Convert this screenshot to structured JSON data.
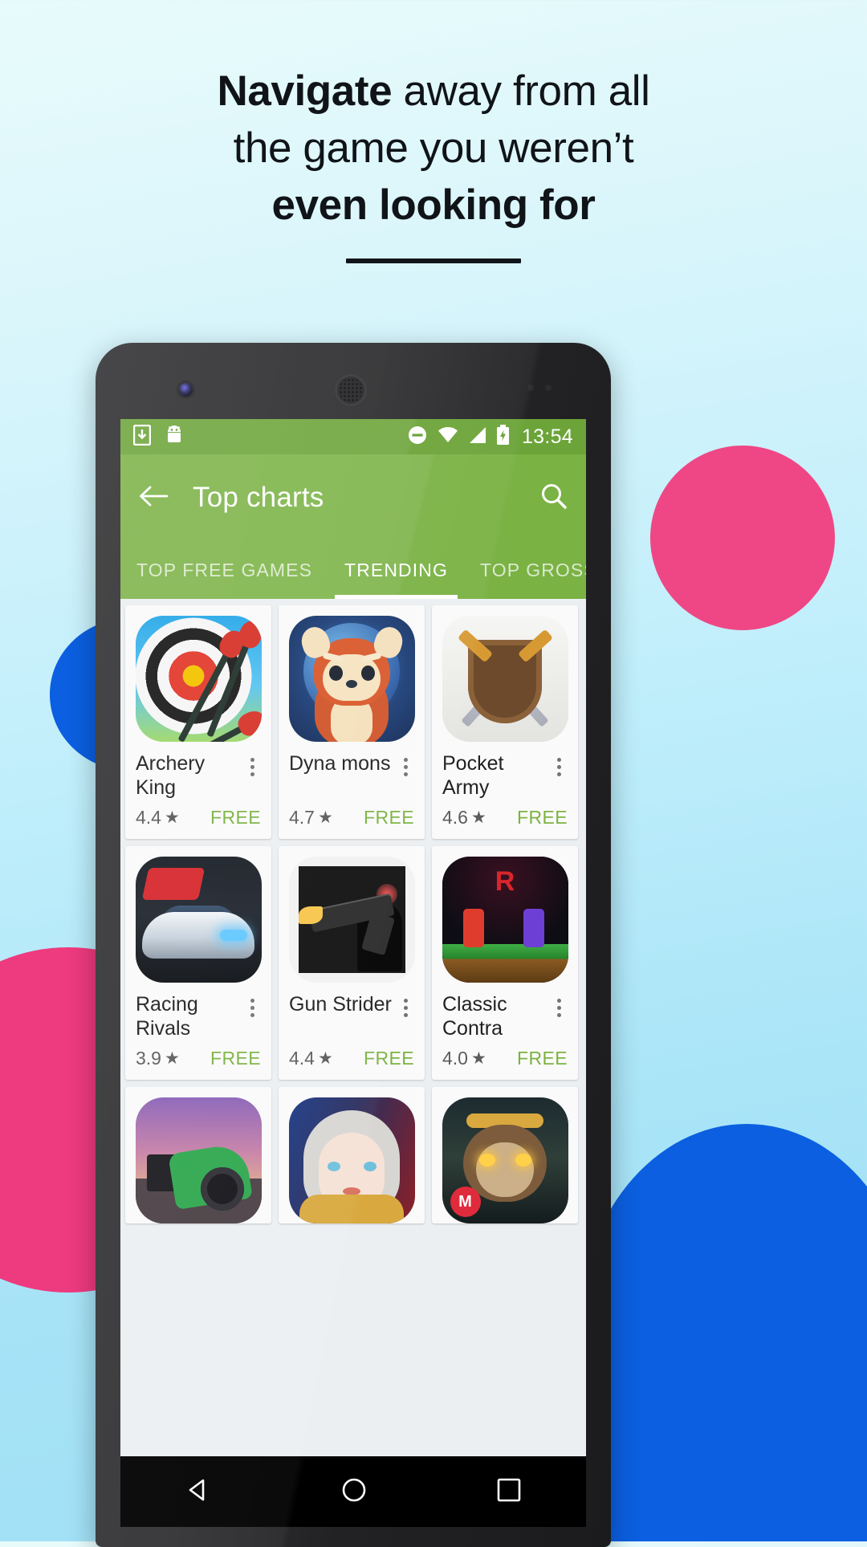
{
  "promo": {
    "headline_line1_bold": "Navigate",
    "headline_line1_rest": " away from all",
    "headline_line2": "the game you weren’t",
    "headline_line3": "even looking for"
  },
  "phone": {
    "statusbar": {
      "time": "13:54",
      "icons_left": [
        "download-icon",
        "android-icon"
      ],
      "icons_right": [
        "do-not-disturb-icon",
        "wifi-icon",
        "signal-icon",
        "battery-charging-icon"
      ]
    },
    "appbar": {
      "back_icon": "back-arrow-icon",
      "title": "Top charts",
      "search_icon": "search-icon"
    },
    "tabs": [
      {
        "label": "TOP FREE GAMES",
        "active": false
      },
      {
        "label": "TRENDING",
        "active": true
      },
      {
        "label": "TOP GROSSING",
        "active": false
      }
    ],
    "apps": [
      {
        "title": "Archery King",
        "rating": "4.4",
        "price": "FREE",
        "art": "art-archery"
      },
      {
        "title": "Dyna mons",
        "rating": "4.7",
        "price": "FREE",
        "art": "art-dyna"
      },
      {
        "title": "Pocket Army",
        "rating": "4.6",
        "price": "FREE",
        "art": "art-pocket"
      },
      {
        "title": "Racing Rivals",
        "rating": "3.9",
        "price": "FREE",
        "art": "art-racing"
      },
      {
        "title": "Gun Strider",
        "rating": "4.4",
        "price": "FREE",
        "art": "art-gun"
      },
      {
        "title": "Classic Contra",
        "rating": "4.0",
        "price": "FREE",
        "art": "art-contra"
      }
    ],
    "apps_partial": [
      {
        "art": "art-moto"
      },
      {
        "art": "art-elf"
      },
      {
        "art": "art-monkey"
      }
    ],
    "navbar": [
      "back-triangle-icon",
      "home-circle-icon",
      "recents-square-icon"
    ]
  },
  "colors": {
    "appbar_green": "#7ab244",
    "statusbar_green": "#6ca439",
    "price_green": "#7cb342",
    "bg_top": "#e8fbfb",
    "bg_bottom": "#9fdff6",
    "blob_pink": "#ee3a7e",
    "blob_blue": "#0b5fe0",
    "blob_green": "#12b86a"
  }
}
